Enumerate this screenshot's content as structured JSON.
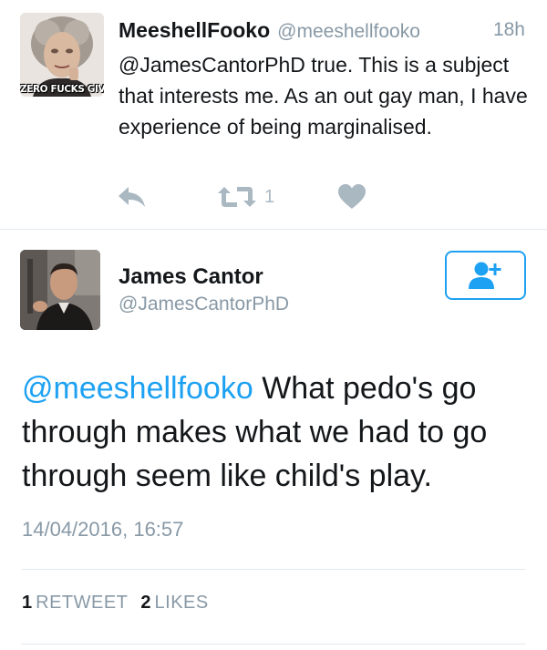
{
  "reply": {
    "avatar_caption": "ZERO FUCKS GIVEN",
    "name": "MeeshellFooko",
    "handle": "@meeshellfooko",
    "time": "18h",
    "text": "@JamesCantorPhD true. This is a subject that interests me. As an out gay man, I have experience of being marginalised.",
    "actions": {
      "reply_icon": "reply-icon",
      "retweet_icon": "retweet-icon",
      "retweet_count": "1",
      "like_icon": "heart-icon"
    }
  },
  "tweet": {
    "name": "James Cantor",
    "handle": "@JamesCantorPhD",
    "follow_icon": "add-user-icon",
    "mention": "@meeshellfooko",
    "text": " What pedo's go through makes what we had to go through seem like child's play.",
    "timestamp": "14/04/2016, 16:57",
    "retweet_count": "1",
    "retweet_label": "RETWEET",
    "like_count": "2",
    "like_label": "LIKES"
  },
  "colors": {
    "accent": "#1da1f2",
    "muted": "#8899a6",
    "icon_grey": "#aab8c2",
    "text": "#14171a",
    "divider": "#e1e8ed"
  }
}
